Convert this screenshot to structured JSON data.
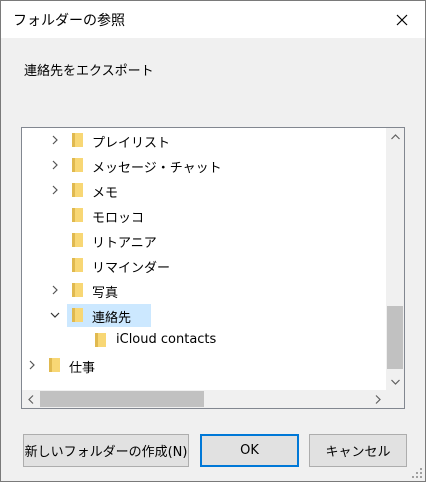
{
  "window": {
    "title": "フォルダーの参照",
    "close_icon": "close-icon"
  },
  "instruction": "連絡先をエクスポート",
  "tree": {
    "items": [
      {
        "label": "プレイリスト",
        "expandable": true,
        "expanded": false,
        "selected": false
      },
      {
        "label": "メッセージ・チャット",
        "expandable": true,
        "expanded": false,
        "selected": false
      },
      {
        "label": "メモ",
        "expandable": true,
        "expanded": false,
        "selected": false
      },
      {
        "label": "モロッコ",
        "expandable": false,
        "expanded": false,
        "selected": false
      },
      {
        "label": "リトアニア",
        "expandable": false,
        "expanded": false,
        "selected": false
      },
      {
        "label": "リマインダー",
        "expandable": false,
        "expanded": false,
        "selected": false
      },
      {
        "label": "写真",
        "expandable": true,
        "expanded": false,
        "selected": false
      },
      {
        "label": "連絡先",
        "expandable": true,
        "expanded": true,
        "selected": true
      },
      {
        "label": "iCloud contacts",
        "expandable": false,
        "expanded": false,
        "selected": false
      },
      {
        "label": "仕事",
        "expandable": true,
        "expanded": false,
        "selected": false
      }
    ]
  },
  "buttons": {
    "new_folder": "新しいフォルダーの作成(N)",
    "ok": "OK",
    "cancel": "キャンセル"
  },
  "colors": {
    "accent": "#0078d7",
    "selection": "#cce8ff",
    "folder": "#f8d775"
  }
}
